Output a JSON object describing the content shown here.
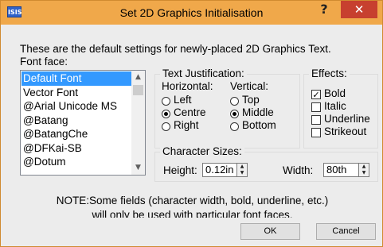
{
  "window": {
    "title": "Set 2D Graphics Initialisation",
    "icon_text": "ISIS",
    "help_glyph": "?",
    "close_glyph": "✕"
  },
  "intro_text": "These are the default settings for newly-placed 2D Graphics Text.",
  "font_face": {
    "label": "Font face:",
    "items": [
      "Default Font",
      "Vector Font",
      "@Arial Unicode MS",
      "@Batang",
      "@BatangChe",
      "@DFKai-SB",
      "@Dotum"
    ],
    "selected": "Default Font"
  },
  "justification": {
    "title": "Text Justification:",
    "horizontal": {
      "label": "Horizontal:",
      "options": [
        "Left",
        "Centre",
        "Right"
      ],
      "selected": "Centre"
    },
    "vertical": {
      "label": "Vertical:",
      "options": [
        "Top",
        "Middle",
        "Bottom"
      ],
      "selected": "Middle"
    }
  },
  "effects": {
    "title": "Effects:",
    "options": [
      {
        "label": "Bold",
        "checked": true
      },
      {
        "label": "Italic",
        "checked": false
      },
      {
        "label": "Underline",
        "checked": false
      },
      {
        "label": "Strikeout",
        "checked": false
      }
    ]
  },
  "character_sizes": {
    "title": "Character Sizes:",
    "height_label": "Height:",
    "height_value": "0.12in",
    "width_label": "Width:",
    "width_value": "80th"
  },
  "note": {
    "line1": "NOTE:Some fields (character width, bold, underline, etc.)",
    "line2": "will only be used with particular font faces."
  },
  "buttons": {
    "ok": "OK",
    "cancel": "Cancel"
  },
  "colors": {
    "titlebar": "#f0a84a",
    "close_button": "#c7402f",
    "selection": "#3399ff"
  }
}
